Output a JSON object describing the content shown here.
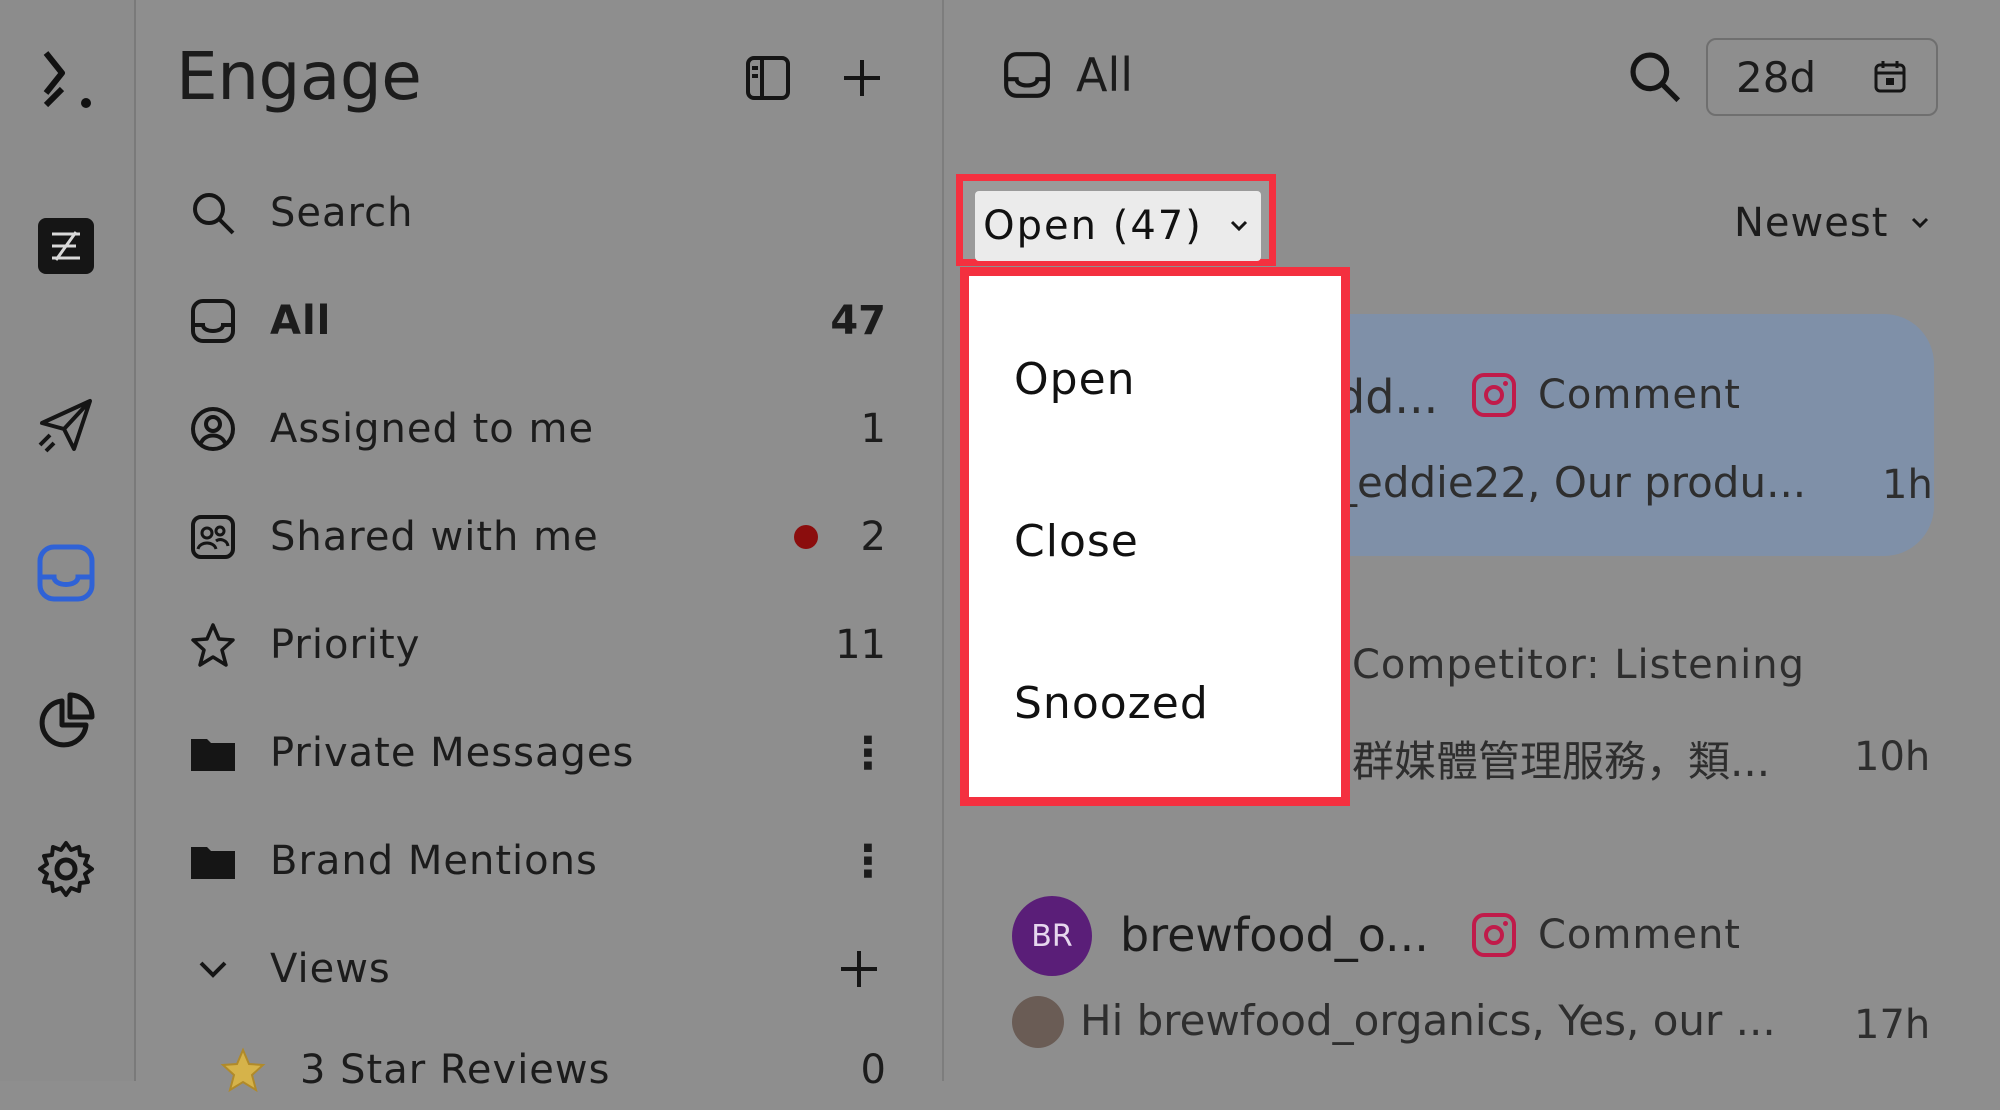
{
  "rail": {
    "icons": [
      "logo-icon",
      "brand-icon",
      "publish-icon",
      "inbox-icon",
      "analytics-icon",
      "settings-icon"
    ],
    "active_color": "#2f62d6"
  },
  "sidebar": {
    "title": "Engage",
    "search": "Search",
    "items": [
      {
        "label": "All",
        "count": "47"
      },
      {
        "label": "Assigned to me",
        "count": "1"
      },
      {
        "label": "Shared with me",
        "count": "2"
      },
      {
        "label": "Priority",
        "count": "11"
      },
      {
        "label": "Private Messages"
      },
      {
        "label": "Brand Mentions"
      }
    ],
    "views_label": "Views",
    "view_items": [
      {
        "label": "3 Star Reviews",
        "count": "0"
      }
    ]
  },
  "main": {
    "title": "All",
    "date_range": "28d",
    "status_button": "Open (47)",
    "sort": "Newest",
    "conversations": [
      {
        "name": "dd...",
        "type": "Comment",
        "snippet": "_eddie22, Our produ...",
        "time": "1h"
      },
      {
        "name": "Competitor: Listening",
        "snippet": "群媒體管理服務，類...",
        "time": "10h"
      },
      {
        "avatar": "BR",
        "name": "brewfood_o...",
        "type": "Comment",
        "snippet": "Hi brewfood_organics, Yes, our ...",
        "time": "17h"
      }
    ]
  },
  "dropdown": {
    "options": [
      "Open",
      "Close",
      "Snoozed"
    ]
  },
  "colors": {
    "highlight": "#f4303f",
    "unread_dot": "#8b0d0d",
    "instagram": "#c01b4a"
  }
}
